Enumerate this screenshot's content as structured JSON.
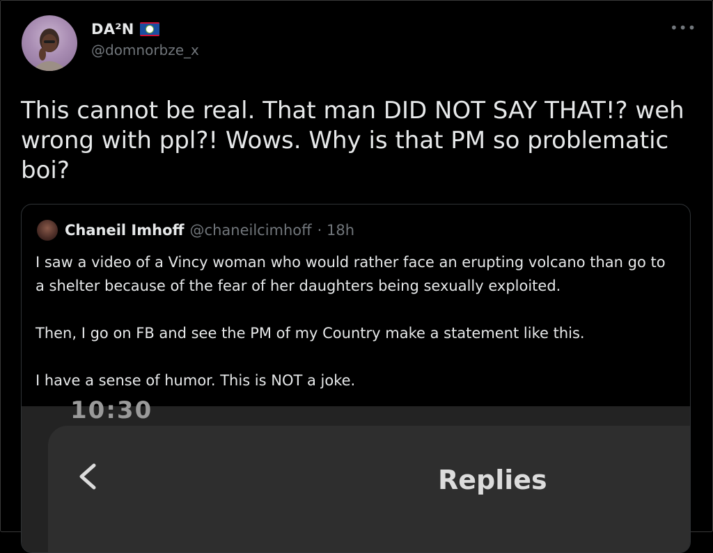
{
  "author": {
    "display_name": "DA²N",
    "handle": "@domnorbze_x",
    "flag": "Belize"
  },
  "more_menu": "•••",
  "tweet_text": "This cannot be real. That man DID NOT SAY THAT!? weh wrong with ppl?! Wows. Why is that PM so problematic boi?",
  "quote": {
    "name": "Chaneil Imhoff",
    "handle": "@chaneilcimhoff",
    "time": "· 18h",
    "text": "I saw a video of a Vincy woman who would rather face an erupting volcano than go to a shelter because of the fear of her daughters being sexually exploited.\n\nThen, I go on FB and see the PM of my Country make a statement like this.\n\nI have a sense of humor. This is NOT a joke.",
    "media": {
      "clock": "10:30",
      "title": "Replies",
      "back_icon": "chevron-left-icon"
    }
  }
}
